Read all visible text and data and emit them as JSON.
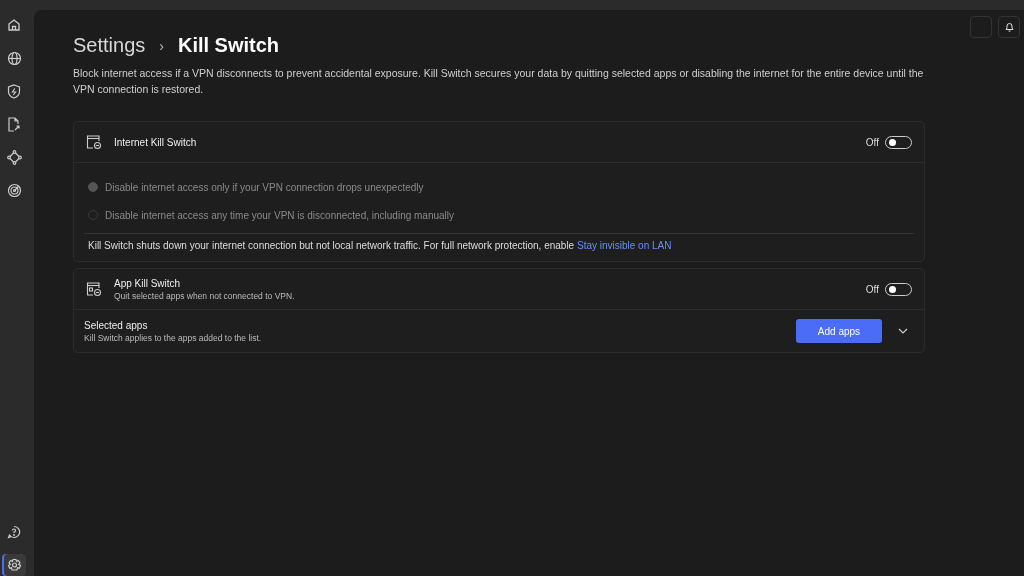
{
  "sidebar": {
    "items": [
      {
        "kind": "home",
        "selected": false
      },
      {
        "kind": "globe",
        "selected": false
      },
      {
        "kind": "shield",
        "selected": false
      },
      {
        "kind": "file",
        "selected": false
      },
      {
        "kind": "nodes",
        "selected": false
      },
      {
        "kind": "target",
        "selected": false
      }
    ],
    "bottom_items": [
      {
        "kind": "help",
        "selected": false
      },
      {
        "kind": "settings",
        "selected": true
      }
    ]
  },
  "breadcrumb": {
    "parent": "Settings",
    "separator": "›",
    "current": "Kill Switch"
  },
  "description": "Block internet access if a VPN disconnects to prevent accidental exposure. Kill Switch secures your data by quitting selected apps or disabling the internet for the entire device until the VPN connection is restored.",
  "internet_kill_switch": {
    "title": "Internet Kill Switch",
    "toggle_label": "Off",
    "on": false,
    "options": [
      {
        "label": "Disable internet access only if your VPN connection drops unexpectedly",
        "selected": true,
        "disabled": true
      },
      {
        "label": "Disable internet access any time your VPN is disconnected, including manually",
        "selected": false,
        "disabled": true
      }
    ],
    "note": "Kill Switch shuts down your internet connection but not local network traffic. For full network protection, enable",
    "note_link": "Stay invisible on LAN"
  },
  "app_kill_switch": {
    "title": "App Kill Switch",
    "subtitle": "Quit selected apps when not connected to VPN.",
    "toggle_label": "Off",
    "on": false,
    "selected_apps": {
      "title": "Selected apps",
      "subtitle": "Kill Switch applies to the apps added to the list.",
      "button": "Add apps",
      "expanded": false
    }
  }
}
